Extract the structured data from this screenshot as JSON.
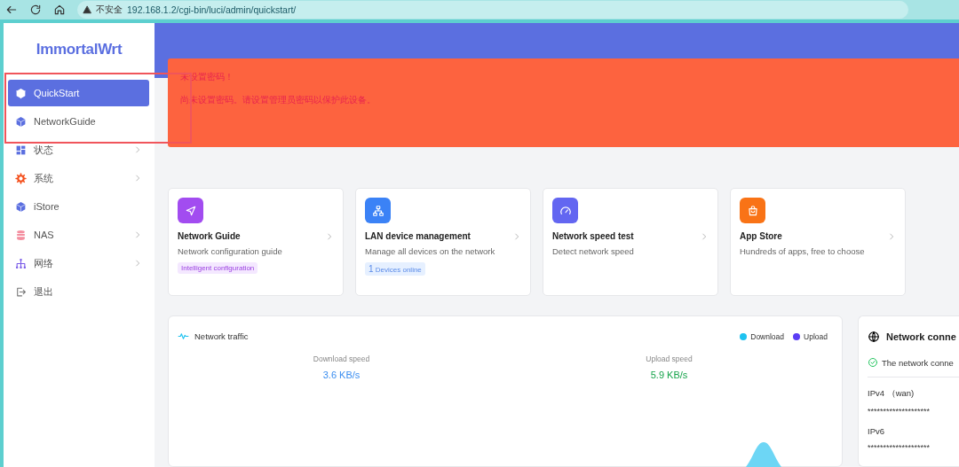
{
  "browser": {
    "security": "不安全",
    "url": "192.168.1.2/cgi-bin/luci/admin/quickstart/"
  },
  "sidebar": {
    "logo": "ImmortalWrt",
    "items": [
      {
        "label": "QuickStart",
        "selected": true,
        "submenu": false
      },
      {
        "label": "NetworkGuide",
        "selected": false,
        "submenu": false
      },
      {
        "label": "状态",
        "selected": false,
        "submenu": true
      },
      {
        "label": "系统",
        "selected": false,
        "submenu": true
      },
      {
        "label": "iStore",
        "selected": false,
        "submenu": false
      },
      {
        "label": "NAS",
        "selected": false,
        "submenu": true
      },
      {
        "label": "网络",
        "selected": false,
        "submenu": true
      },
      {
        "label": "退出",
        "selected": false,
        "submenu": false
      }
    ]
  },
  "alert": {
    "title": "未设置密码！",
    "message": "尚未设置密码。请设置管理员密码以保护此设备。"
  },
  "cards": [
    {
      "title": "Network Guide",
      "subtitle": "Network configuration guide",
      "color": "#a24cf0",
      "tag": {
        "kind": "text",
        "text": "Intelligent configuration"
      }
    },
    {
      "title": "LAN device management",
      "subtitle": "Manage all devices on the network",
      "color": "#3b82f6",
      "tag": {
        "kind": "count",
        "count": "1",
        "text": "Devices online"
      }
    },
    {
      "title": "Network speed test",
      "subtitle": "Detect network speed",
      "color": "#6366f1"
    },
    {
      "title": "App Store",
      "subtitle": "Hundreds of apps, free to choose",
      "color": "#f97316"
    }
  ],
  "traffic": {
    "title": "Network traffic",
    "legend": [
      {
        "label": "Download",
        "color": "#1ec2f0"
      },
      {
        "label": "Upload",
        "color": "#5b3df5"
      }
    ],
    "stats": [
      {
        "label": "Download speed",
        "value": "3.6 KB/s",
        "color": "#3b8ef0"
      },
      {
        "label": "Upload speed",
        "value": "5.9 KB/s",
        "color": "#16a34a"
      }
    ]
  },
  "connection": {
    "title": "Network conne",
    "status": "The network conne",
    "rows": [
      {
        "label": "IPv4 （wan)",
        "value": "********************"
      },
      {
        "label": "IPv6",
        "value": "********************"
      }
    ]
  }
}
